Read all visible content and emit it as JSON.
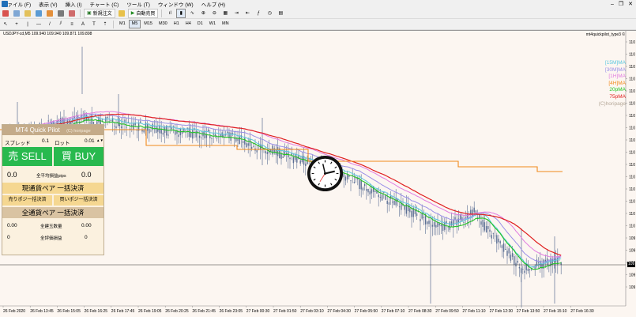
{
  "menu": [
    "ファイル (F)",
    "表示 (V)",
    "挿入 (I)",
    "チャート (C)",
    "ツール (T)",
    "ウィンドウ (W)",
    "ヘルプ (H)"
  ],
  "toolbar": {
    "new_order": "新規注文",
    "auto_trade": "自動売買"
  },
  "timeframes": [
    "M1",
    "M5",
    "M15",
    "M30",
    "H1",
    "H4",
    "D1",
    "W1",
    "MN"
  ],
  "chart": {
    "title": "USDJPY-cd,M5  109.940 109.940 109.871 109.898",
    "indicator_name": "mt4quickpilot_type3 ©",
    "price_labels": [
      "110",
      "110",
      "110",
      "110",
      "110",
      "110",
      "110",
      "110",
      "110",
      "110",
      "110",
      "110",
      "110",
      "110",
      "110",
      "110",
      "109",
      "109",
      "109",
      "109",
      "109"
    ],
    "current_price_label": "109",
    "time_labels": [
      "26 Feb 2020",
      "26 Feb 13:45",
      "26 Feb 15:05",
      "26 Feb 16:25",
      "26 Feb 17:45",
      "26 Feb 19:05",
      "26 Feb 20:25",
      "26 Feb 21:45",
      "26 Feb 23:05",
      "27 Feb 00:30",
      "27 Feb 01:50",
      "27 Feb 03:10",
      "27 Feb 04:30",
      "27 Feb 05:50",
      "27 Feb 07:10",
      "27 Feb 08:30",
      "27 Feb 09:50",
      "27 Feb 11:10",
      "27 Feb 12:30",
      "27 Feb 13:50",
      "27 Feb 15:10",
      "27 Feb 16:30"
    ]
  },
  "legend": [
    {
      "label": "[15M]MA",
      "color": "#5bc8e0"
    },
    {
      "label": "[30M]MA",
      "color": "#9a8fe8"
    },
    {
      "label": "[1H]MA",
      "color": "#e07be0"
    },
    {
      "label": "[4H]MA",
      "color": "#f08a1c"
    },
    {
      "label": "20pMA",
      "color": "#22c422"
    },
    {
      "label": "75pMA",
      "color": "#e02020"
    },
    {
      "label": "(C)horipage",
      "color": "#b5a898"
    }
  ],
  "panel": {
    "title": "MT4 Quick Pilot",
    "copyright": "(C) horipage",
    "spread_label": "スプレッド",
    "spread_value": "0.1",
    "lot_label": "ロット",
    "lot_value": "0.01",
    "lot_arrows": "▲▼",
    "sell_label": "売 SELL",
    "buy_label": "買 BUY",
    "avg_left": "0.0",
    "avg_label": "全平均損益pips",
    "avg_right": "0.0",
    "close_pair_label": "現通貨ペア 一括決済",
    "close_sell_label": "売りポジ一括決済",
    "close_buy_label": "買いポジ一括決済",
    "close_all_label": "全通貨ペア 一括決済",
    "total_lots_left": "0.00",
    "total_lots_label": "全建玉数量",
    "total_lots_right": "0.00",
    "total_pl_left": "0",
    "total_pl_label": "全評価損益",
    "total_pl_right": "0"
  },
  "colors": {
    "chart_bg": "#fcf6f1",
    "candle": "#5b6f94",
    "sell_buy": "#28b94e",
    "button": "#f5d791",
    "panel_header": "#c4ab89"
  }
}
